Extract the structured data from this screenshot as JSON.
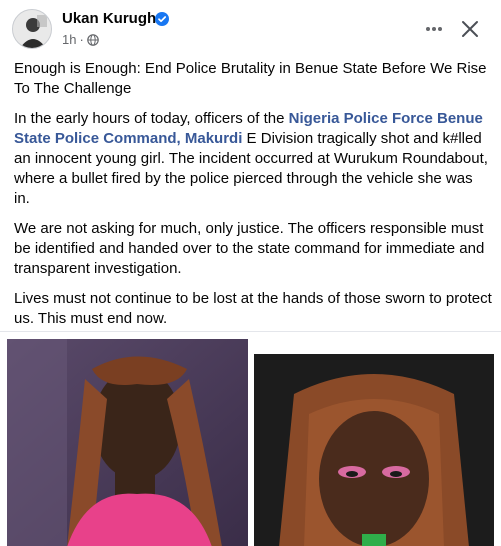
{
  "author": {
    "name": "Ukan Kurugh",
    "verified_icon": "verified-badge-icon",
    "time": "1h",
    "separator": "·",
    "audience_icon": "globe-icon"
  },
  "header_actions": {
    "more_icon": "more-options-icon",
    "close_icon": "close-icon"
  },
  "post": {
    "title": "Enough is Enough: End Police Brutality in Benue State Before We Rise To The Challenge",
    "p1_before": "In the early hours of today, officers of the ",
    "p1_link": "Nigeria Police Force Benue State Police Command, Makurdi",
    "p1_after": " E Division tragically shot and k#lled an innocent young girl. The incident occurred at Wurukum Roundabout, where a bullet fired by the police pierced through the vehicle she was in.",
    "p2": "We are not asking for much, only justice. The officers responsible must be identified and handed over to the state command for immediate and transparent investigation.",
    "p3": "Lives must not continue to be lost at the hands of those sworn to protect us. This must end now."
  },
  "colors": {
    "link": "#385898",
    "verified": "#1877f2",
    "secondary_text": "#65676b"
  }
}
